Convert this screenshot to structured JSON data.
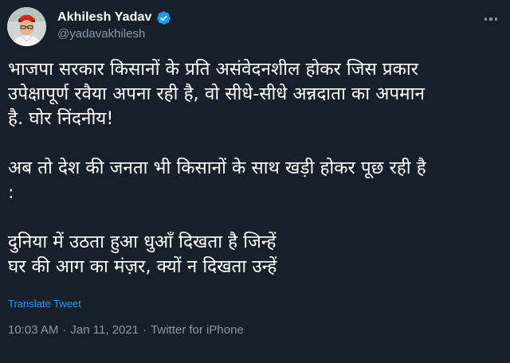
{
  "author": {
    "display_name": "Akhilesh Yadav",
    "handle": "@yadavakhilesh",
    "verified": true
  },
  "tweet": {
    "lines": [
      "भाजपा सरकार किसानों के प्रति असंवेदनशील होकर जिस प्रकार",
      "उपेक्षापूर्ण रवैया अपना रही है, वो सीधे-सीधे अन्नदाता का अपमान",
      "है. घोर निंदनीय!",
      "",
      "अब तो देश की जनता भी किसानों के साथ खड़ी होकर पूछ रही है",
      ":",
      "",
      "दुनिया में उठता हुआ धुआँ दिखता है जिन्हें",
      "घर की आग का मंज़र, क्यों न दिखता उन्हें"
    ],
    "translate_label": "Translate Tweet",
    "time": "10:03 AM",
    "date": "Jan 11, 2021",
    "source": "Twitter for iPhone",
    "separator": "·"
  },
  "icons": {
    "more": "more-options-icon",
    "verified": "verified-badge-icon"
  },
  "colors": {
    "background": "#15202b",
    "text_primary": "#ffffff",
    "text_secondary": "#8b98a5",
    "link": "#1d9bf0",
    "verified_badge": "#1d9bf0"
  }
}
